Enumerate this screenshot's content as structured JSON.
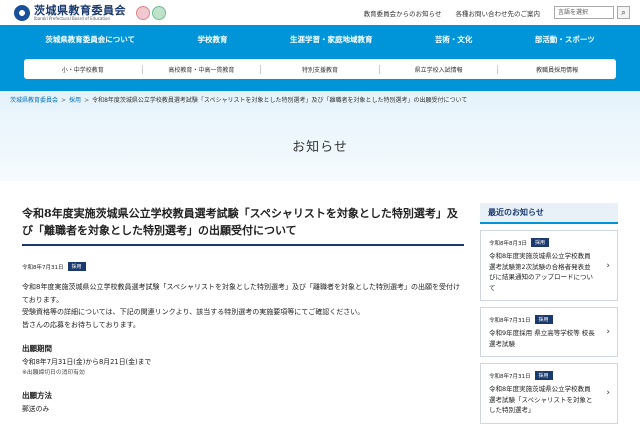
{
  "header": {
    "logo_text": "茨城県教育委員会",
    "logo_en": "Ibaraki Prefectural Board of Education",
    "links": [
      "教育委員会からのお知らせ",
      "各種お問い合わせ先のご案内"
    ],
    "search_placeholder": "言語を選択",
    "search_icon": "search-icon"
  },
  "nav": {
    "main": [
      "茨城県教育委員会について",
      "学校教育",
      "生涯学習・家庭地域教育",
      "芸術・文化",
      "部活動・スポーツ"
    ],
    "sub": [
      "小・中学校教育",
      "高校教育・中高一貫教育",
      "特別支援教育",
      "県立学校入試情報",
      "教職員採用情報"
    ]
  },
  "breadcrumb": {
    "items": [
      "茨城県教育委員会",
      "採用"
    ],
    "current": "令和8年度茨城県公立学校教員選考試験「スペシャリストを対象とした特別選考」及び「離職者を対象とした特別選考」の出願受付について"
  },
  "hero": {
    "title": "お知らせ"
  },
  "article": {
    "title": "令和8年度実施茨城県公立学校教員選考試験「スペシャリストを対象とした特別選考」及び「離職者を対象とした特別選考」の出願受付について",
    "date": "令和8年7月31日",
    "badge": "採用",
    "para1": "令和8年度実施茨城県公立学校教員選考試験「スペシャリストを対象とした特別選考」及び「離職者を対象とした特別選考」の出願を受付けております。",
    "para2": "受験資格等の詳細については、下記の関連リンクより、該当する特別選考の実施要項等にてご確認ください。",
    "para3": "皆さんの応募をお待ちしております。",
    "period_heading": "出願期間",
    "period_text": "令和8年7月31日(金)から8月21日(金)まで",
    "period_note": "※出願締切日の消印有効",
    "method_heading": "出願方法",
    "method_text": "郵送のみ"
  },
  "sidebar": {
    "heading": "最近のお知らせ",
    "items": [
      {
        "date": "令和8年8月3日",
        "badge": "採用",
        "title": "令和8年度実施茨城県公立学校教員選考試験第2次試験の合格者発表並びに結果通知のアップロードについて"
      },
      {
        "date": "令和8年7月31日",
        "badge": "採用",
        "title": "令和9年度採用 県立高等学校等 校長選考試験"
      },
      {
        "date": "令和8年7月31日",
        "badge": "採用",
        "title": "令和8年度実施茨城県公立学校教員選考試験「スペシャリストを対象とした特別選考」"
      }
    ]
  }
}
